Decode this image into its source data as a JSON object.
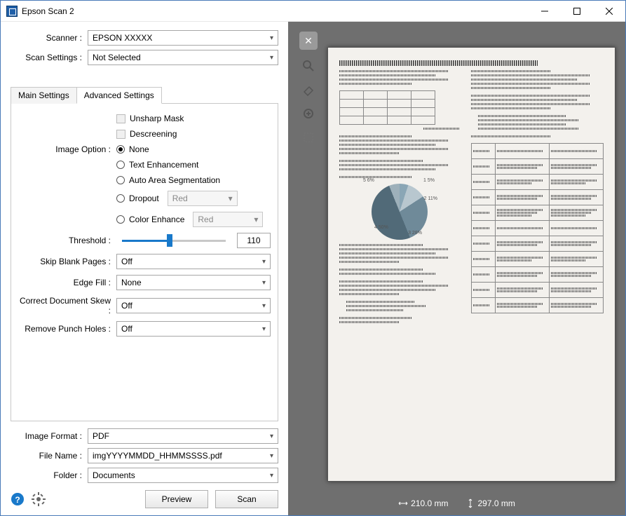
{
  "window": {
    "title": "Epson Scan 2"
  },
  "top": {
    "scanner_label": "Scanner :",
    "scanner_value": "EPSON XXXXX",
    "scan_settings_label": "Scan Settings :",
    "scan_settings_value": "Not Selected"
  },
  "tabs": {
    "main": "Main Settings",
    "advanced": "Advanced Settings"
  },
  "adv": {
    "unsharp": "Unsharp Mask",
    "descreening": "Descreening",
    "image_option_label": "Image Option :",
    "opt_none": "None",
    "opt_text_enh": "Text Enhancement",
    "opt_auto_seg": "Auto Area Segmentation",
    "opt_dropout": "Dropout",
    "opt_color_enh": "Color Enhance",
    "color_red": "Red",
    "threshold_label": "Threshold :",
    "threshold_value": "110",
    "skip_blank_label": "Skip Blank Pages :",
    "skip_blank_value": "Off",
    "edge_fill_label": "Edge Fill :",
    "edge_fill_value": "None",
    "skew_label": "Correct Document Skew :",
    "skew_value": "Off",
    "punch_label": "Remove Punch Holes :",
    "punch_value": "Off"
  },
  "bottom": {
    "image_format_label": "Image Format :",
    "image_format_value": "PDF",
    "file_name_label": "File Name :",
    "file_name_value": "imgYYYYMMDD_HHMMSSSS.pdf",
    "folder_label": "Folder :",
    "folder_value": "Documents",
    "preview_btn": "Preview",
    "scan_btn": "Scan"
  },
  "status": {
    "width": "210.0 mm",
    "height": "297.0 mm"
  },
  "chart_data": {
    "type": "pie",
    "title": "",
    "series": [
      {
        "name": "1",
        "value": 5
      },
      {
        "name": "2",
        "value": 11
      },
      {
        "name": "3",
        "value": 28
      },
      {
        "name": "4",
        "value": 50
      },
      {
        "name": "5",
        "value": 6
      }
    ],
    "labels": [
      "1 5%",
      "2 11%",
      "3 28%",
      "4 50%",
      "5 6%"
    ]
  }
}
